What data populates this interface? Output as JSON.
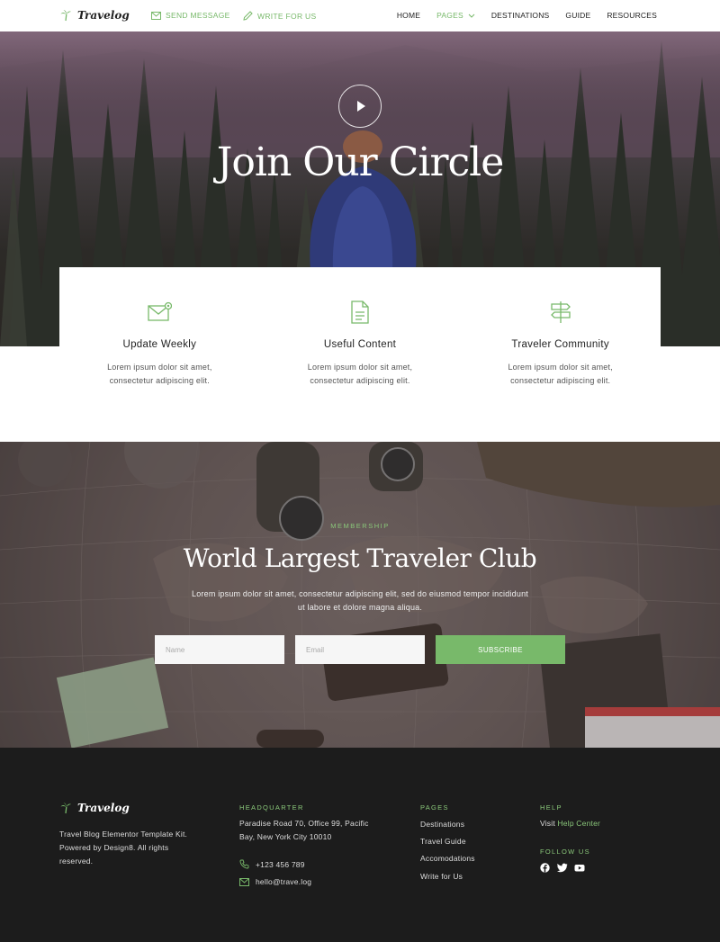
{
  "nav": {
    "brand": "Travelog",
    "send_message": "SEND MESSAGE",
    "write_for_us": "WRITE FOR US",
    "menu": [
      "HOME",
      "PAGES",
      "DESTINATIONS",
      "GUIDE",
      "RESOURCES"
    ],
    "active": "PAGES"
  },
  "hero": {
    "title": "Join Our Circle"
  },
  "features": [
    {
      "icon": "mail-icon",
      "title": "Update Weekly",
      "text": "Lorem ipsum dolor sit amet, consectetur adipiscing elit."
    },
    {
      "icon": "document-icon",
      "title": "Useful Content",
      "text": "Lorem ipsum dolor sit amet, consectetur adipiscing elit."
    },
    {
      "icon": "signpost-icon",
      "title": "Traveler Community",
      "text": "Lorem ipsum dolor sit amet, consectetur adipiscing elit."
    }
  ],
  "club": {
    "eyebrow": "MEMBERSHIP",
    "title": "World Largest Traveler Club",
    "text": "Lorem ipsum dolor sit amet, consectetur adipiscing elit, sed do eiusmod tempor incididunt ut labore et dolore magna aliqua.",
    "name_placeholder": "Name",
    "email_placeholder": "Email",
    "subscribe": "SUBSCRIBE"
  },
  "footer": {
    "brand": "Travelog",
    "about": "Travel Blog Elementor Template Kit. Powered by Design8. All rights reserved.",
    "hq_heading": "HEADQUARTER",
    "address": "Paradise Road 70, Office 99, Pacific Bay,  New York City 10010",
    "phone": "+123 456 789",
    "email": "hello@trave.log",
    "pages_heading": "PAGES",
    "pages": [
      "Destinations",
      "Travel Guide",
      "Accomodations",
      "Write for Us"
    ],
    "help_heading": "HELP",
    "help_prefix": "Visit ",
    "help_link": "Help Center",
    "follow_heading": "FOLLOW US",
    "social": [
      "facebook-icon",
      "twitter-icon",
      "youtube-icon"
    ]
  },
  "colors": {
    "accent": "#78b96a",
    "footer_bg": "#1c1c1c"
  }
}
